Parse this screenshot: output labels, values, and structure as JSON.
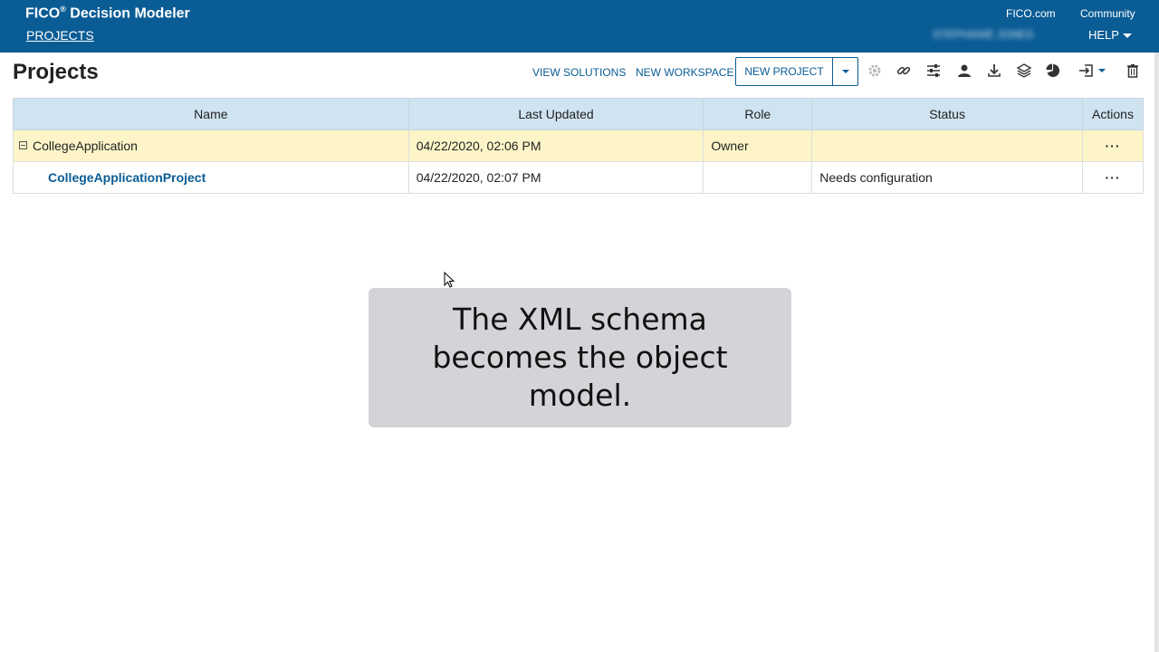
{
  "header": {
    "brand": "FICO",
    "brand_mark": "®",
    "brand_suffix": " Decision Modeler",
    "nav_projects": "PROJECTS",
    "link_fico": "FICO.com",
    "link_community": "Community",
    "user_name": "STEPHANIE JONES",
    "help": "HELP"
  },
  "page": {
    "title": "Projects"
  },
  "toolbar": {
    "view_solutions": "VIEW SOLUTIONS",
    "new_workspace": "NEW WORKSPACE",
    "new_project": "NEW PROJECT",
    "icons": [
      "gear-icon",
      "link-icon",
      "sliders-icon",
      "user-icon",
      "download-icon",
      "layers-icon",
      "pie-chart-icon",
      "export-icon",
      "trash-icon"
    ]
  },
  "table": {
    "headers": [
      "Name",
      "Last Updated",
      "Role",
      "Status",
      "Actions"
    ],
    "rows": [
      {
        "name": "CollegeApplication",
        "updated": "04/22/2020, 02:06 PM",
        "role": "Owner",
        "status": "",
        "actions": "···"
      },
      {
        "name": "CollegeApplicationProject",
        "updated": "04/22/2020, 02:07 PM",
        "role": "",
        "status": "Needs configuration",
        "actions": "···"
      }
    ]
  },
  "caption": {
    "line1": "The XML schema",
    "line2": "becomes the object",
    "line3": "model."
  },
  "colors": {
    "header_bg": "#0a5c95",
    "table_header_bg": "#cfe3f1",
    "group_row_bg": "#fdf5c8",
    "caption_bg": "#d3d4d7"
  }
}
